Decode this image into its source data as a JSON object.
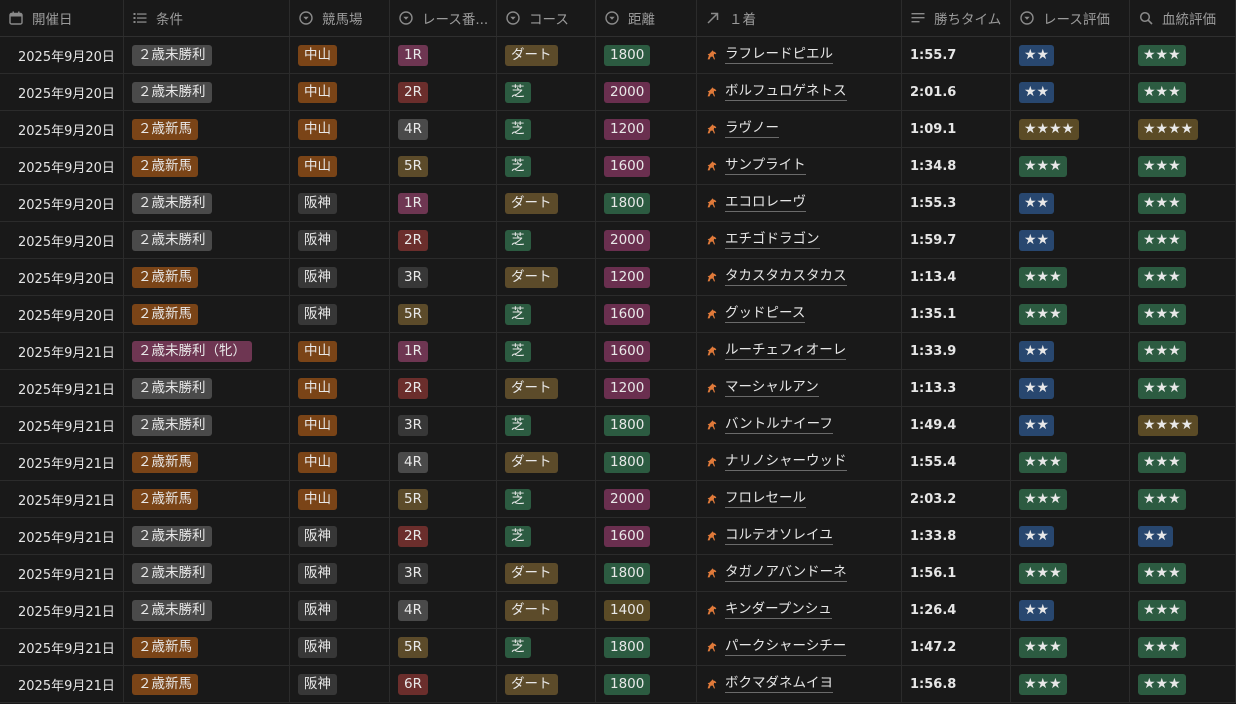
{
  "headers": {
    "date": "開催日",
    "condition": "条件",
    "venue": "競馬場",
    "race": "レース番...",
    "course": "コース",
    "distance": "距離",
    "winner": "１着",
    "time": "勝ちタイム",
    "race_eval": "レース評価",
    "blood_eval": "血統評価"
  },
  "header_icons": {
    "date": "calendar-icon",
    "condition": "list-icon",
    "venue": "select-icon",
    "race": "select-icon",
    "course": "select-icon",
    "distance": "select-icon",
    "winner": "relation-arrow-icon",
    "time": "text-lines-icon",
    "race_eval": "select-icon",
    "blood_eval": "search-icon"
  },
  "colors": {
    "gray": "#4a4a4a",
    "brown": "#7a4417",
    "pink": "#6e3652",
    "dark": "#373737",
    "red": "#6b2e2c",
    "olive": "#5c4b2a",
    "green": "#2c5b41",
    "purple": "#6a2f4f",
    "tan": "#5b4b26",
    "blue": "#28476f"
  },
  "rows": [
    {
      "date": "2025年9月20日",
      "condition": {
        "text": "２歳未勝利",
        "color": "gray"
      },
      "venue": {
        "text": "中山",
        "color": "brown"
      },
      "race": {
        "text": "1R",
        "color": "pink"
      },
      "course": {
        "text": "ダート",
        "color": "olive"
      },
      "distance": {
        "text": "1800",
        "color": "green"
      },
      "winner": "ラフレードピエル",
      "time": "1:55.7",
      "race_eval": {
        "text": "★★",
        "color": "blue"
      },
      "blood_eval": {
        "text": "★★★",
        "color": "green"
      }
    },
    {
      "date": "2025年9月20日",
      "condition": {
        "text": "２歳未勝利",
        "color": "gray"
      },
      "venue": {
        "text": "中山",
        "color": "brown"
      },
      "race": {
        "text": "2R",
        "color": "red"
      },
      "course": {
        "text": "芝",
        "color": "green"
      },
      "distance": {
        "text": "2000",
        "color": "purple"
      },
      "winner": "ボルフュロゲネトス",
      "time": "2:01.6",
      "race_eval": {
        "text": "★★",
        "color": "blue"
      },
      "blood_eval": {
        "text": "★★★",
        "color": "green"
      }
    },
    {
      "date": "2025年9月20日",
      "condition": {
        "text": "２歳新馬",
        "color": "brown"
      },
      "venue": {
        "text": "中山",
        "color": "brown"
      },
      "race": {
        "text": "4R",
        "color": "gray"
      },
      "course": {
        "text": "芝",
        "color": "green"
      },
      "distance": {
        "text": "1200",
        "color": "purple"
      },
      "winner": "ラヴノー",
      "time": "1:09.1",
      "race_eval": {
        "text": "★★★★",
        "color": "tan"
      },
      "blood_eval": {
        "text": "★★★★",
        "color": "tan"
      }
    },
    {
      "date": "2025年9月20日",
      "condition": {
        "text": "２歳新馬",
        "color": "brown"
      },
      "venue": {
        "text": "中山",
        "color": "brown"
      },
      "race": {
        "text": "5R",
        "color": "olive"
      },
      "course": {
        "text": "芝",
        "color": "green"
      },
      "distance": {
        "text": "1600",
        "color": "purple"
      },
      "winner": "サンプライト",
      "time": "1:34.8",
      "race_eval": {
        "text": "★★★",
        "color": "green"
      },
      "blood_eval": {
        "text": "★★★",
        "color": "green"
      }
    },
    {
      "date": "2025年9月20日",
      "condition": {
        "text": "２歳未勝利",
        "color": "gray"
      },
      "venue": {
        "text": "阪神",
        "color": "dark"
      },
      "race": {
        "text": "1R",
        "color": "pink"
      },
      "course": {
        "text": "ダート",
        "color": "olive"
      },
      "distance": {
        "text": "1800",
        "color": "green"
      },
      "winner": "エコロレーヴ",
      "time": "1:55.3",
      "race_eval": {
        "text": "★★",
        "color": "blue"
      },
      "blood_eval": {
        "text": "★★★",
        "color": "green"
      }
    },
    {
      "date": "2025年9月20日",
      "condition": {
        "text": "２歳未勝利",
        "color": "gray"
      },
      "venue": {
        "text": "阪神",
        "color": "dark"
      },
      "race": {
        "text": "2R",
        "color": "red"
      },
      "course": {
        "text": "芝",
        "color": "green"
      },
      "distance": {
        "text": "2000",
        "color": "purple"
      },
      "winner": "エチゴドラゴン",
      "time": "1:59.7",
      "race_eval": {
        "text": "★★",
        "color": "blue"
      },
      "blood_eval": {
        "text": "★★★",
        "color": "green"
      }
    },
    {
      "date": "2025年9月20日",
      "condition": {
        "text": "２歳新馬",
        "color": "brown"
      },
      "venue": {
        "text": "阪神",
        "color": "dark"
      },
      "race": {
        "text": "3R",
        "color": "dark"
      },
      "course": {
        "text": "ダート",
        "color": "olive"
      },
      "distance": {
        "text": "1200",
        "color": "purple"
      },
      "winner": "タカスタカスタカス",
      "time": "1:13.4",
      "race_eval": {
        "text": "★★★",
        "color": "green"
      },
      "blood_eval": {
        "text": "★★★",
        "color": "green"
      }
    },
    {
      "date": "2025年9月20日",
      "condition": {
        "text": "２歳新馬",
        "color": "brown"
      },
      "venue": {
        "text": "阪神",
        "color": "dark"
      },
      "race": {
        "text": "5R",
        "color": "olive"
      },
      "course": {
        "text": "芝",
        "color": "green"
      },
      "distance": {
        "text": "1600",
        "color": "purple"
      },
      "winner": "グッドピース",
      "time": "1:35.1",
      "race_eval": {
        "text": "★★★",
        "color": "green"
      },
      "blood_eval": {
        "text": "★★★",
        "color": "green"
      }
    },
    {
      "date": "2025年9月21日",
      "condition": {
        "text": "２歳未勝利（牝）",
        "color": "pink"
      },
      "venue": {
        "text": "中山",
        "color": "brown"
      },
      "race": {
        "text": "1R",
        "color": "pink"
      },
      "course": {
        "text": "芝",
        "color": "green"
      },
      "distance": {
        "text": "1600",
        "color": "purple"
      },
      "winner": "ルーチェフィオーレ",
      "time": "1:33.9",
      "race_eval": {
        "text": "★★",
        "color": "blue"
      },
      "blood_eval": {
        "text": "★★★",
        "color": "green"
      }
    },
    {
      "date": "2025年9月21日",
      "condition": {
        "text": "２歳未勝利",
        "color": "gray"
      },
      "venue": {
        "text": "中山",
        "color": "brown"
      },
      "race": {
        "text": "2R",
        "color": "red"
      },
      "course": {
        "text": "ダート",
        "color": "olive"
      },
      "distance": {
        "text": "1200",
        "color": "purple"
      },
      "winner": "マーシャルアン",
      "time": "1:13.3",
      "race_eval": {
        "text": "★★",
        "color": "blue"
      },
      "blood_eval": {
        "text": "★★★",
        "color": "green"
      }
    },
    {
      "date": "2025年9月21日",
      "condition": {
        "text": "２歳未勝利",
        "color": "gray"
      },
      "venue": {
        "text": "中山",
        "color": "brown"
      },
      "race": {
        "text": "3R",
        "color": "dark"
      },
      "course": {
        "text": "芝",
        "color": "green"
      },
      "distance": {
        "text": "1800",
        "color": "green"
      },
      "winner": "バントルナイーフ",
      "time": "1:49.4",
      "race_eval": {
        "text": "★★",
        "color": "blue"
      },
      "blood_eval": {
        "text": "★★★★",
        "color": "tan"
      }
    },
    {
      "date": "2025年9月21日",
      "condition": {
        "text": "２歳新馬",
        "color": "brown"
      },
      "venue": {
        "text": "中山",
        "color": "brown"
      },
      "race": {
        "text": "4R",
        "color": "gray"
      },
      "course": {
        "text": "ダート",
        "color": "olive"
      },
      "distance": {
        "text": "1800",
        "color": "green"
      },
      "winner": "ナリノシャーウッド",
      "time": "1:55.4",
      "race_eval": {
        "text": "★★★",
        "color": "green"
      },
      "blood_eval": {
        "text": "★★★",
        "color": "green"
      }
    },
    {
      "date": "2025年9月21日",
      "condition": {
        "text": "２歳新馬",
        "color": "brown"
      },
      "venue": {
        "text": "中山",
        "color": "brown"
      },
      "race": {
        "text": "5R",
        "color": "olive"
      },
      "course": {
        "text": "芝",
        "color": "green"
      },
      "distance": {
        "text": "2000",
        "color": "purple"
      },
      "winner": "フロレセール",
      "time": "2:03.2",
      "race_eval": {
        "text": "★★★",
        "color": "green"
      },
      "blood_eval": {
        "text": "★★★",
        "color": "green"
      }
    },
    {
      "date": "2025年9月21日",
      "condition": {
        "text": "２歳未勝利",
        "color": "gray"
      },
      "venue": {
        "text": "阪神",
        "color": "dark"
      },
      "race": {
        "text": "2R",
        "color": "red"
      },
      "course": {
        "text": "芝",
        "color": "green"
      },
      "distance": {
        "text": "1600",
        "color": "purple"
      },
      "winner": "コルテオソレイユ",
      "time": "1:33.8",
      "race_eval": {
        "text": "★★",
        "color": "blue"
      },
      "blood_eval": {
        "text": "★★",
        "color": "blue"
      }
    },
    {
      "date": "2025年9月21日",
      "condition": {
        "text": "２歳未勝利",
        "color": "gray"
      },
      "venue": {
        "text": "阪神",
        "color": "dark"
      },
      "race": {
        "text": "3R",
        "color": "dark"
      },
      "course": {
        "text": "ダート",
        "color": "olive"
      },
      "distance": {
        "text": "1800",
        "color": "green"
      },
      "winner": "タガノアバンドーネ",
      "time": "1:56.1",
      "race_eval": {
        "text": "★★★",
        "color": "green"
      },
      "blood_eval": {
        "text": "★★★",
        "color": "green"
      }
    },
    {
      "date": "2025年9月21日",
      "condition": {
        "text": "２歳未勝利",
        "color": "gray"
      },
      "venue": {
        "text": "阪神",
        "color": "dark"
      },
      "race": {
        "text": "4R",
        "color": "gray"
      },
      "course": {
        "text": "ダート",
        "color": "olive"
      },
      "distance": {
        "text": "1400",
        "color": "tan"
      },
      "winner": "キンダープンシュ",
      "time": "1:26.4",
      "race_eval": {
        "text": "★★",
        "color": "blue"
      },
      "blood_eval": {
        "text": "★★★",
        "color": "green"
      }
    },
    {
      "date": "2025年9月21日",
      "condition": {
        "text": "２歳新馬",
        "color": "brown"
      },
      "venue": {
        "text": "阪神",
        "color": "dark"
      },
      "race": {
        "text": "5R",
        "color": "olive"
      },
      "course": {
        "text": "芝",
        "color": "green"
      },
      "distance": {
        "text": "1800",
        "color": "green"
      },
      "winner": "パークシャーシチー",
      "time": "1:47.2",
      "race_eval": {
        "text": "★★★",
        "color": "green"
      },
      "blood_eval": {
        "text": "★★★",
        "color": "green"
      }
    },
    {
      "date": "2025年9月21日",
      "condition": {
        "text": "２歳新馬",
        "color": "brown"
      },
      "venue": {
        "text": "阪神",
        "color": "dark"
      },
      "race": {
        "text": "6R",
        "color": "red"
      },
      "course": {
        "text": "ダート",
        "color": "olive"
      },
      "distance": {
        "text": "1800",
        "color": "green"
      },
      "winner": "ボクマダネムイヨ",
      "time": "1:56.8",
      "race_eval": {
        "text": "★★★",
        "color": "green"
      },
      "blood_eval": {
        "text": "★★★",
        "color": "green"
      }
    }
  ]
}
